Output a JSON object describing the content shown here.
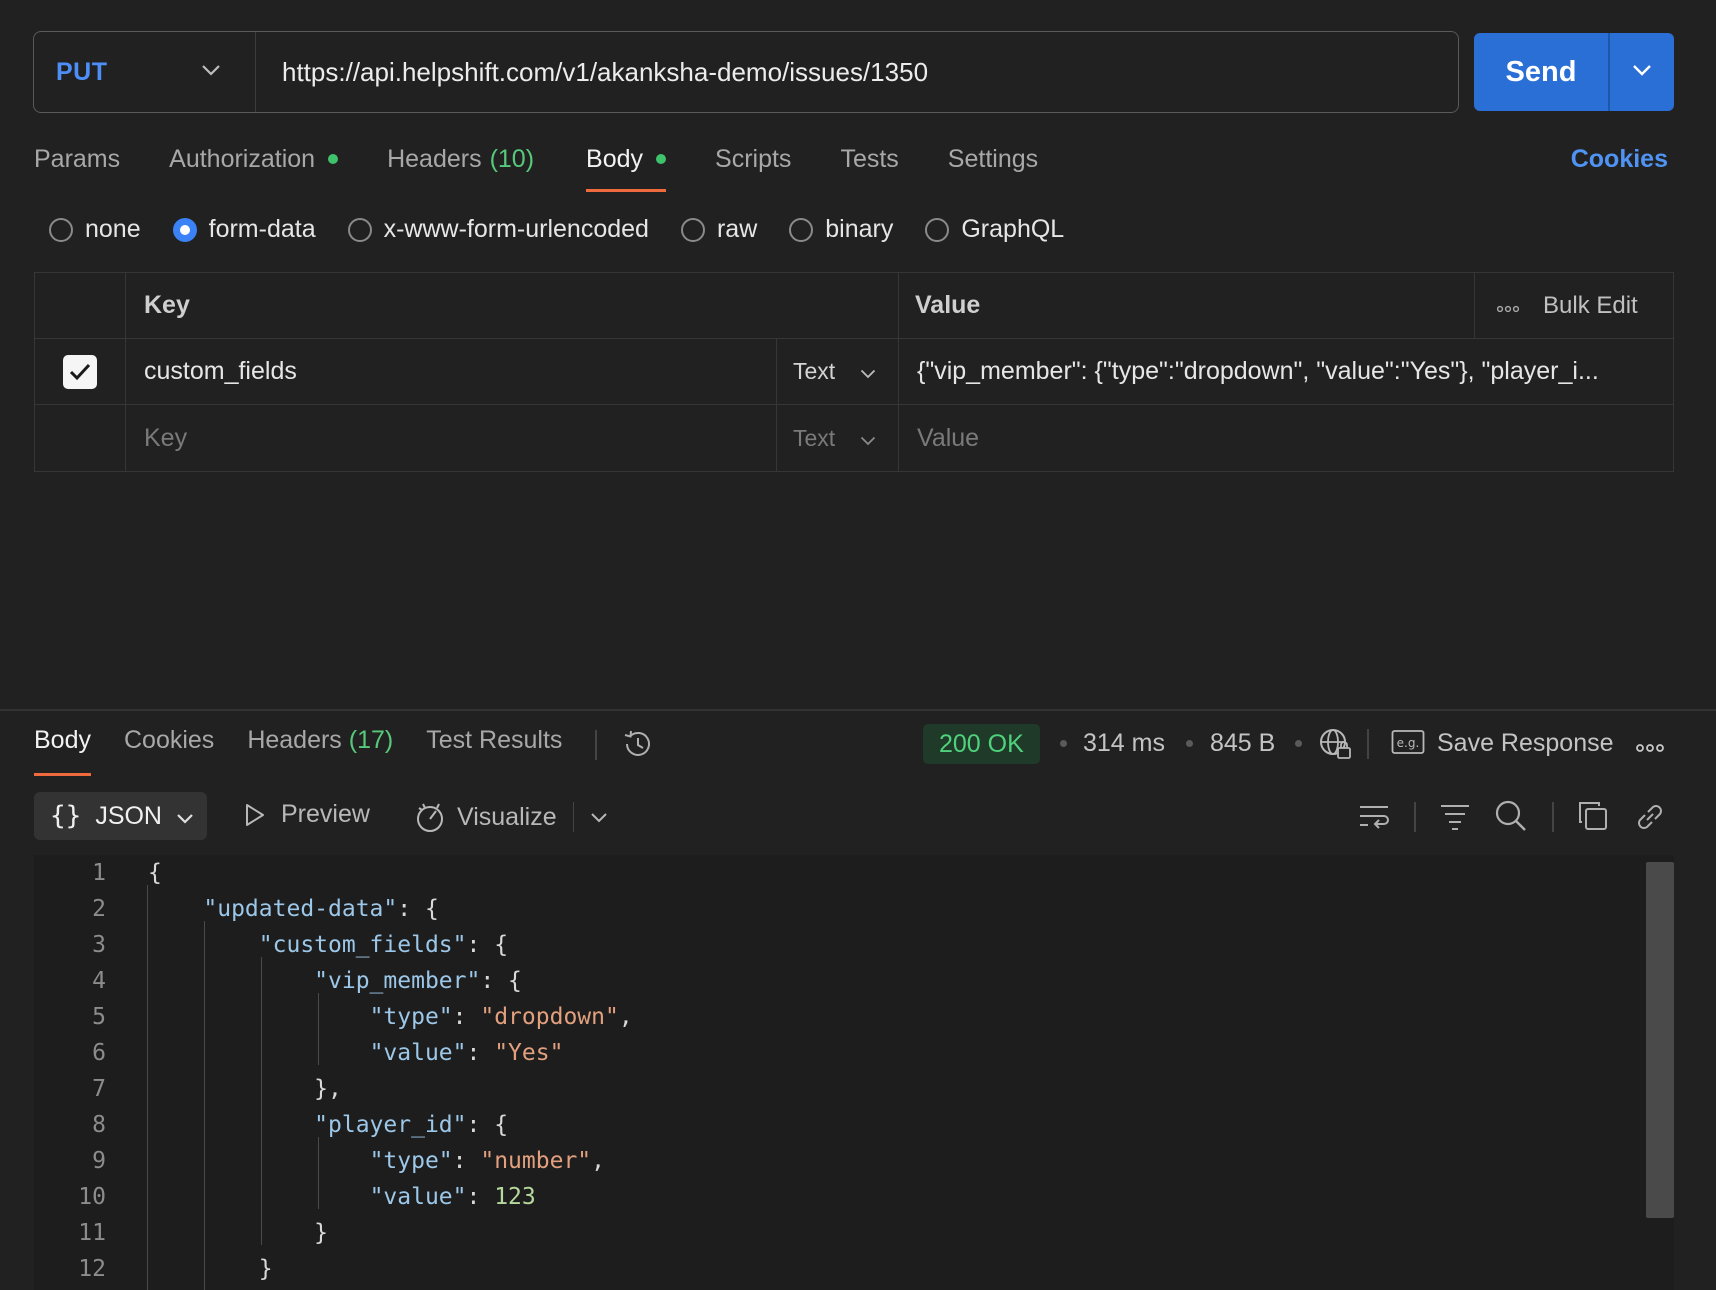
{
  "request": {
    "method": "PUT",
    "url": "https://api.helpshift.com/v1/akanksha-demo/issues/1350",
    "send_label": "Send"
  },
  "request_tabs": {
    "params": "Params",
    "authorization": "Authorization",
    "headers": "Headers",
    "headers_count": "(10)",
    "body": "Body",
    "scripts": "Scripts",
    "tests": "Tests",
    "settings": "Settings",
    "cookies": "Cookies"
  },
  "body_types": {
    "none": "none",
    "form_data": "form-data",
    "urlencoded": "x-www-form-urlencoded",
    "raw": "raw",
    "binary": "binary",
    "graphql": "GraphQL",
    "selected": "form-data"
  },
  "form_table": {
    "key_header": "Key",
    "value_header": "Value",
    "bulk_edit": "Bulk Edit",
    "rows": [
      {
        "checked": true,
        "key": "custom_fields",
        "type": "Text",
        "value": "{\"vip_member\": {\"type\":\"dropdown\", \"value\":\"Yes\"}, \"player_i..."
      }
    ],
    "new_row": {
      "key_placeholder": "Key",
      "type": "Text",
      "value_placeholder": "Value"
    }
  },
  "response_tabs": {
    "body": "Body",
    "cookies": "Cookies",
    "headers": "Headers",
    "headers_count": "(17)",
    "test_results": "Test Results"
  },
  "response_meta": {
    "status": "200 OK",
    "time": "314 ms",
    "size": "845 B",
    "save_response": "Save Response",
    "status_color": "#4fd27c"
  },
  "response_toolbar": {
    "format": "JSON",
    "preview": "Preview",
    "visualize": "Visualize"
  },
  "response_lines": [
    {
      "n": "1",
      "text": "{"
    },
    {
      "n": "2",
      "text": "    \"updated-data\": {"
    },
    {
      "n": "3",
      "text": "        \"custom_fields\": {"
    },
    {
      "n": "4",
      "text": "            \"vip_member\": {"
    },
    {
      "n": "5",
      "text": "                \"type\": \"dropdown\","
    },
    {
      "n": "6",
      "text": "                \"value\": \"Yes\""
    },
    {
      "n": "7",
      "text": "            },"
    },
    {
      "n": "8",
      "text": "            \"player_id\": {"
    },
    {
      "n": "9",
      "text": "                \"type\": \"number\","
    },
    {
      "n": "10",
      "text": "                \"value\": 123"
    },
    {
      "n": "11",
      "text": "            }"
    },
    {
      "n": "12",
      "text": "        }"
    }
  ],
  "colors": {
    "accent": "#2a6fd6",
    "method": "#4d8ef7",
    "active_tab_underline": "#ef6a3c",
    "dot_green": "#3ec26b"
  }
}
